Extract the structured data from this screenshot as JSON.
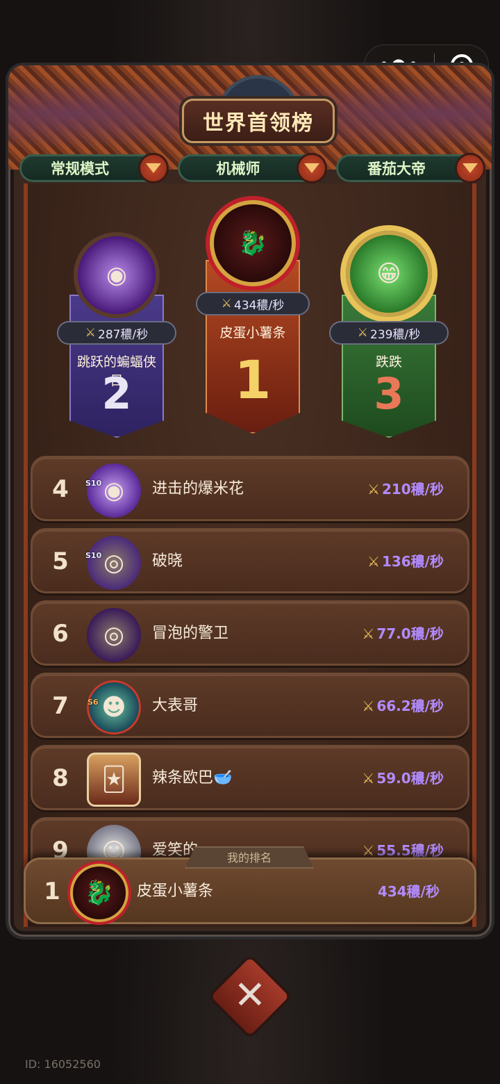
{
  "title": "世界首领榜",
  "filters": [
    {
      "label": "常规模式"
    },
    {
      "label": "机械师"
    },
    {
      "label": "番茄大帝"
    }
  ],
  "podium": {
    "first": {
      "rank": "1",
      "name": "皮蛋小薯条",
      "score": "434穠/秒"
    },
    "second": {
      "rank": "2",
      "name": "跳跃的蝙蝠侠 目",
      "score": "287穠/秒"
    },
    "third": {
      "rank": "3",
      "name": "跌跌",
      "score": "239穠/秒"
    }
  },
  "list": [
    {
      "rank": "4",
      "name": "进击的爆米花",
      "score": "210穠/秒",
      "badge": "S10"
    },
    {
      "rank": "5",
      "name": "破晓",
      "score": "136穠/秒",
      "badge": "S10"
    },
    {
      "rank": "6",
      "name": "冒泡的警卫",
      "score": "77.0穠/秒",
      "badge": ""
    },
    {
      "rank": "7",
      "name": "大表哥",
      "score": "66.2穠/秒",
      "badge": "S6"
    },
    {
      "rank": "8",
      "name": "辣条欧巴🥣",
      "score": "59.0穠/秒",
      "badge": ""
    },
    {
      "rank": "9",
      "name": "爱笑的",
      "score": "55.5穠/秒",
      "badge": ""
    }
  ],
  "my_rank": {
    "tab": "我的排名",
    "rank": "1",
    "name": "皮蛋小薯条",
    "score": "434穠/秒"
  },
  "id_text": "ID: 16052560",
  "icons": {
    "sword": "crossed-swords-icon",
    "dropdown": "triangle-down-icon",
    "close": "close-x-icon",
    "menu": "more-dots-icon",
    "target": "target-icon"
  },
  "colors": {
    "score": "#b28cff",
    "title": "#ffe9b8",
    "filter_text": "#dff5c8"
  }
}
